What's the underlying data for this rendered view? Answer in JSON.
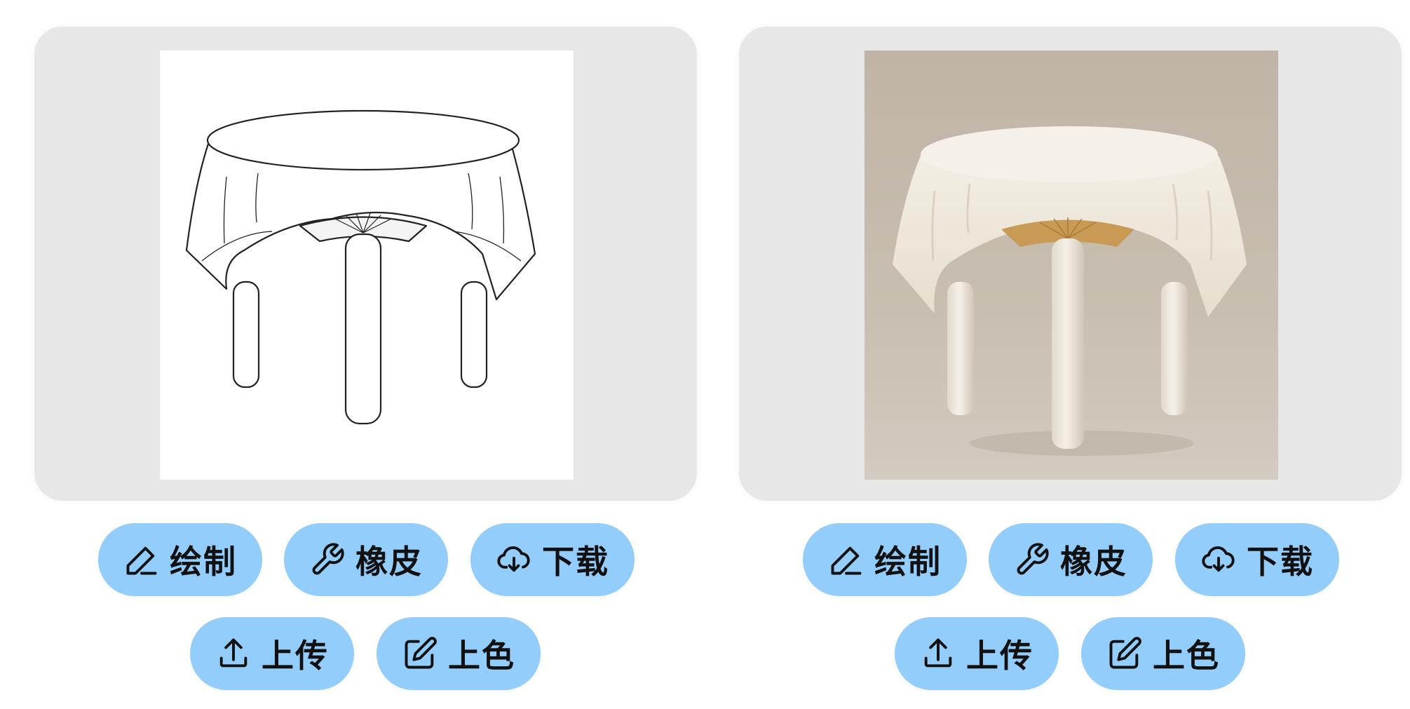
{
  "colors": {
    "card_background": "#e7e7e7",
    "button_background": "#93cdfb",
    "button_text": "#111111"
  },
  "panels": [
    {
      "image": {
        "kind": "line-drawing",
        "subject": "round table with tablecloth"
      },
      "buttons": [
        {
          "label": "绘制",
          "icon": "pencil-icon"
        },
        {
          "label": "橡皮",
          "icon": "wrench-icon"
        },
        {
          "label": "下载",
          "icon": "cloud-download-icon"
        },
        {
          "label": "上传",
          "icon": "upload-icon"
        },
        {
          "label": "上色",
          "icon": "edit-square-icon"
        }
      ]
    },
    {
      "image": {
        "kind": "photo",
        "subject": "round table with tablecloth"
      },
      "buttons": [
        {
          "label": "绘制",
          "icon": "pencil-icon"
        },
        {
          "label": "橡皮",
          "icon": "wrench-icon"
        },
        {
          "label": "下载",
          "icon": "cloud-download-icon"
        },
        {
          "label": "上传",
          "icon": "upload-icon"
        },
        {
          "label": "上色",
          "icon": "edit-square-icon"
        }
      ]
    }
  ]
}
